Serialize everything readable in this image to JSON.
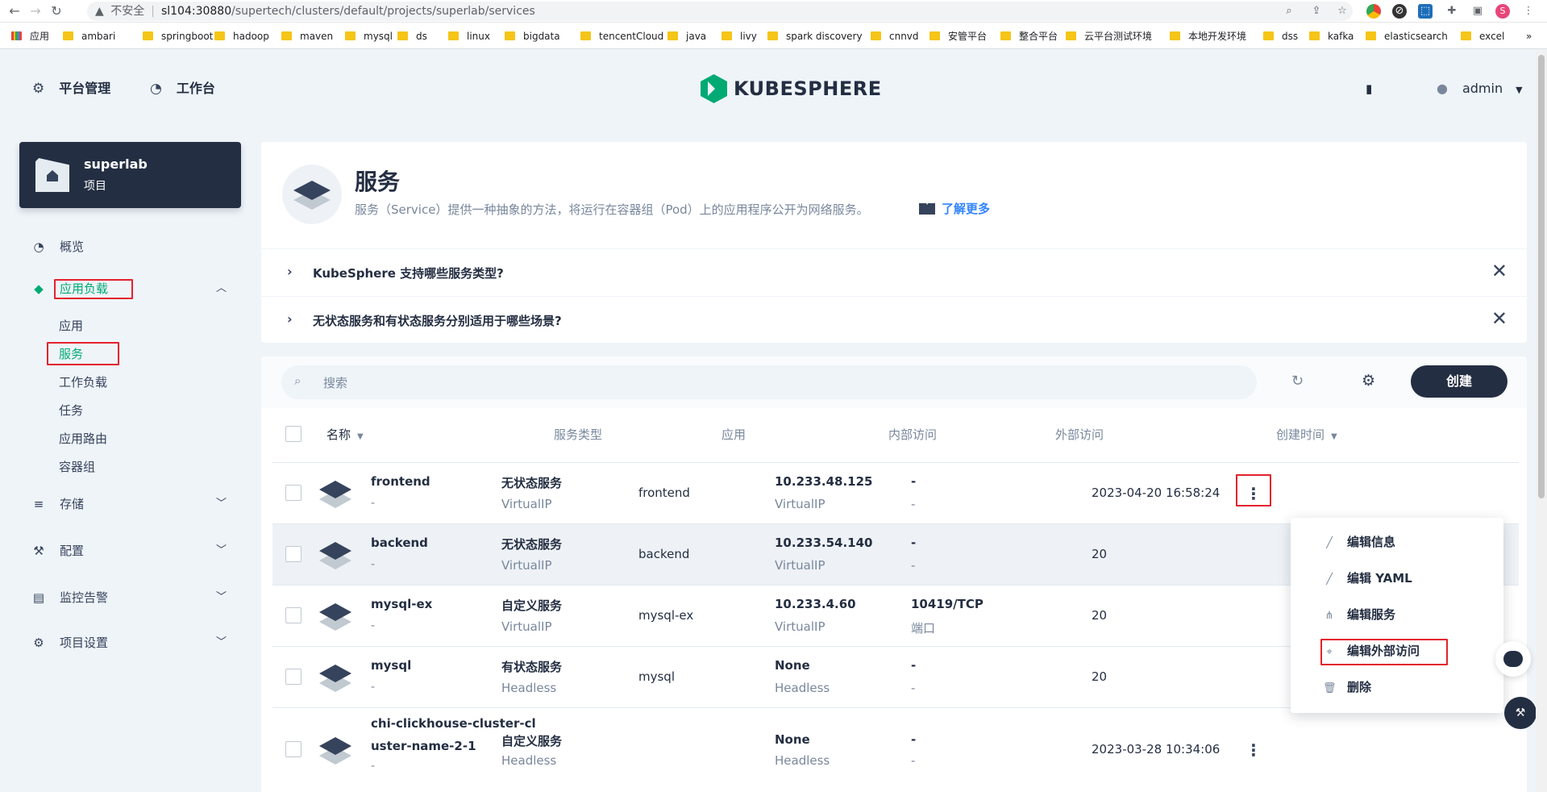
{
  "browser": {
    "security_label": "不安全",
    "url_host": "sl104:30880",
    "url_path": "/supertech/clusters/default/projects/superlab/services",
    "profile_initial": "S",
    "bookmarks": [
      "应用",
      "ambari",
      "springboot",
      "hadoop",
      "maven",
      "mysql",
      "ds",
      "linux",
      "bigdata",
      "tencentCloud",
      "java",
      "livy",
      "spark discovery",
      "cnnvd",
      "安管平台",
      "整合平台",
      "云平台测试环境",
      "本地开发环境",
      "dss",
      "kafka",
      "elasticsearch",
      "excel"
    ]
  },
  "topnav": {
    "platform": "平台管理",
    "workbench": "工作台",
    "logo": "KUBESPHERE",
    "user": "admin"
  },
  "project": {
    "name": "superlab",
    "type": "项目"
  },
  "sidebar": {
    "overview": "概览",
    "workloads": "应用负载",
    "workload_items": [
      "应用",
      "服务",
      "工作负载",
      "任务",
      "应用路由",
      "容器组"
    ],
    "storage": "存储",
    "config": "配置",
    "monitoring": "监控告警",
    "settings": "项目设置"
  },
  "header": {
    "title": "服务",
    "desc": "服务（Service）提供一种抽象的方法，将运行在容器组（Pod）上的应用程序公开为网络服务。",
    "learn_more": "了解更多"
  },
  "faq": [
    "KubeSphere 支持哪些服务类型?",
    "无状态服务和有状态服务分别适用于哪些场景?"
  ],
  "toolbar": {
    "search_placeholder": "搜索",
    "create": "创建"
  },
  "table": {
    "columns": [
      "名称",
      "服务类型",
      "应用",
      "内部访问",
      "外部访问",
      "创建时间"
    ],
    "rows": [
      {
        "name": "frontend",
        "desc": "-",
        "type": "无状态服务",
        "type_sub": "VirtualIP",
        "app": "frontend",
        "internal": "10.233.48.125",
        "internal_sub": "VirtualIP",
        "external": "-",
        "external_sub": "-",
        "created": "2023-04-20 16:58:24"
      },
      {
        "name": "backend",
        "desc": "-",
        "type": "无状态服务",
        "type_sub": "VirtualIP",
        "app": "backend",
        "internal": "10.233.54.140",
        "internal_sub": "VirtualIP",
        "external": "-",
        "external_sub": "-",
        "created": "20"
      },
      {
        "name": "mysql-ex",
        "desc": "-",
        "type": "自定义服务",
        "type_sub": "VirtualIP",
        "app": "mysql-ex",
        "internal": "10.233.4.60",
        "internal_sub": "VirtualIP",
        "external": "10419/TCP",
        "external_sub": "端口",
        "created": "20"
      },
      {
        "name": "mysql",
        "desc": "-",
        "type": "有状态服务",
        "type_sub": "Headless",
        "app": "mysql",
        "internal": "None",
        "internal_sub": "Headless",
        "external": "-",
        "external_sub": "-",
        "created": "20"
      },
      {
        "name": "chi-clickhouse-cluster-cl",
        "name2": "uster-name-2-1",
        "desc": "-",
        "type": "自定义服务",
        "type_sub": "Headless",
        "app": "",
        "internal": "None",
        "internal_sub": "Headless",
        "external": "-",
        "external_sub": "-",
        "created": "2023-03-28 10:34:06"
      }
    ]
  },
  "menu": [
    "编辑信息",
    "编辑 YAML",
    "编辑服务",
    "编辑外部访问",
    "删除"
  ],
  "colors": {
    "accent": "#00aa72",
    "dark": "#242e42",
    "highlight": "#e4222c",
    "link": "#3385ff"
  }
}
